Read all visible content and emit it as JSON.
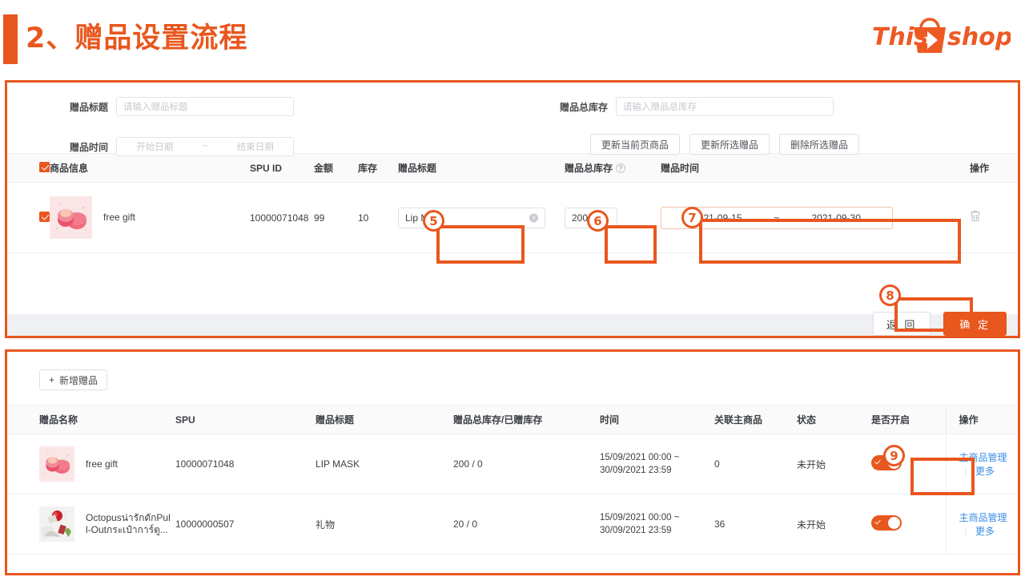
{
  "header": {
    "title": "2、赠品设置流程",
    "logo_text_1": "This",
    "logo_text_2": "shop"
  },
  "filter": {
    "gift_title_label": "赠品标题",
    "gift_title_placeholder": "请输入赠品标题",
    "gift_stock_label": "赠品总库存",
    "gift_stock_placeholder": "请输入赠品总库存",
    "gift_time_label": "赠品时间",
    "date_start_placeholder": "开始日期",
    "date_sep": "~",
    "date_end_placeholder": "结束日期",
    "buttons": [
      {
        "label": "更新当前页商品"
      },
      {
        "label": "更新所选赠品"
      },
      {
        "label": "删除所选赠品"
      }
    ]
  },
  "edit_table": {
    "columns": [
      "商品信息",
      "SPU ID",
      "金额",
      "库存",
      "赠品标题",
      "赠品总库存",
      "赠品时间",
      "操作"
    ],
    "stock_help_icon": "?",
    "rows": [
      {
        "checked": true,
        "product_name": "free gift",
        "spu_id": "10000071048",
        "amount": "99",
        "stock": "10",
        "gift_title": "Lip Mask",
        "gift_title_clear": "×",
        "gift_total_stock": "200",
        "date_start": "2021-09-15",
        "date_sep": "~",
        "date_end": "2021-09-30",
        "delete_icon": "🗑"
      }
    ]
  },
  "footer": {
    "back_label": "返 回",
    "confirm_label": "确 定"
  },
  "list_panel": {
    "add_button_label": "新增赠品",
    "add_button_icon": "+",
    "columns": [
      "赠品名称",
      "SPU",
      "赠品标题",
      "赠品总库存/已赠库存",
      "时间",
      "关联主商品",
      "状态",
      "是否开启",
      "操作"
    ],
    "rows": [
      {
        "name": "free gift",
        "spu": "10000071048",
        "gift_title": "LIP MASK",
        "stock": "200 / 0",
        "time": "15/09/2021 00:00 ~ 30/09/2021 23:59",
        "related_products": "0",
        "status": "未开始",
        "enabled": true,
        "action_manage": "主商品管理",
        "action_more": "更多"
      },
      {
        "name": "Octopusน่ารักดักPul l-Outกระเป๋าการ์ตู...",
        "spu": "10000000507",
        "gift_title": "礼物",
        "stock": "20 / 0",
        "time": "15/09/2021 00:00 ~ 30/09/2021 23:59",
        "related_products": "36",
        "status": "未开始",
        "enabled": true,
        "action_manage": "主商品管理",
        "action_more": "更多"
      }
    ]
  },
  "step_badges": [
    {
      "number": "5"
    },
    {
      "number": "6"
    },
    {
      "number": "7"
    },
    {
      "number": "8"
    },
    {
      "number": "9"
    }
  ],
  "colors": {
    "brand_orange": "#e8571e",
    "link_blue": "#3a8ee6",
    "panel_bg": "#eef0f3"
  }
}
